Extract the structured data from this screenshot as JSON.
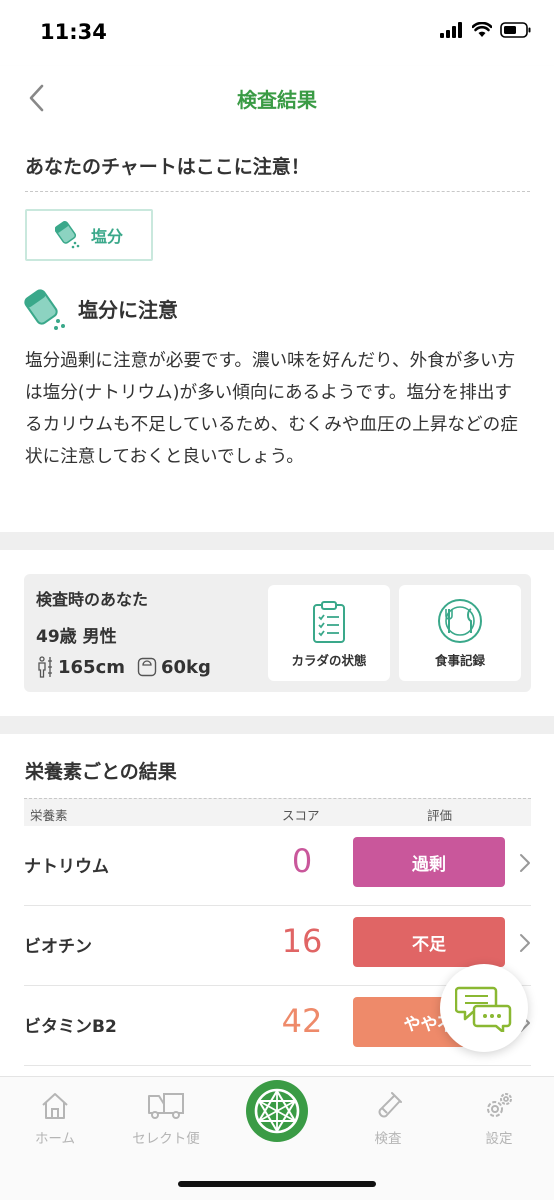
{
  "status_bar": {
    "time": "11:34"
  },
  "nav": {
    "title": "検査結果"
  },
  "alert_section": {
    "heading": "あなたのチャートはここに注意！",
    "chip_label": "塩分",
    "warning_title": "塩分に注意",
    "description": "塩分過剰に注意が必要です。濃い味を好んだり、外食が多い方は塩分(ナトリウム)が多い傾向にあるようです。塩分を排出するカリウムも不足しているため、むくみや血圧の上昇などの症状に注意しておくと良いでしょう。"
  },
  "profile": {
    "title": "検査時のあなた",
    "age_gender": "49歳 男性",
    "height": "165cm",
    "weight": "60kg",
    "body_button": "カラダの状態",
    "meal_button": "食事記録"
  },
  "results": {
    "heading": "栄養素ごとの結果",
    "columns": {
      "nutrient": "栄養素",
      "score": "スコア",
      "rating": "評価"
    },
    "rows": [
      {
        "name": "ナトリウム",
        "score": "0",
        "rating": "過剰",
        "score_color": "#c9579b",
        "badge_color": "#c9579b"
      },
      {
        "name": "ビオチン",
        "score": "16",
        "rating": "不足",
        "score_color": "#e06565",
        "badge_color": "#e06565"
      },
      {
        "name": "ビタミンB2",
        "score": "42",
        "rating": "やや不",
        "score_color": "#ee8a6a",
        "badge_color": "#ee8a6a"
      }
    ]
  },
  "tabbar": {
    "home": "ホーム",
    "select": "セレクト便",
    "test": "検査",
    "settings": "設定"
  },
  "colors": {
    "accent": "#3a9b45",
    "teal": "#3aa88a"
  }
}
